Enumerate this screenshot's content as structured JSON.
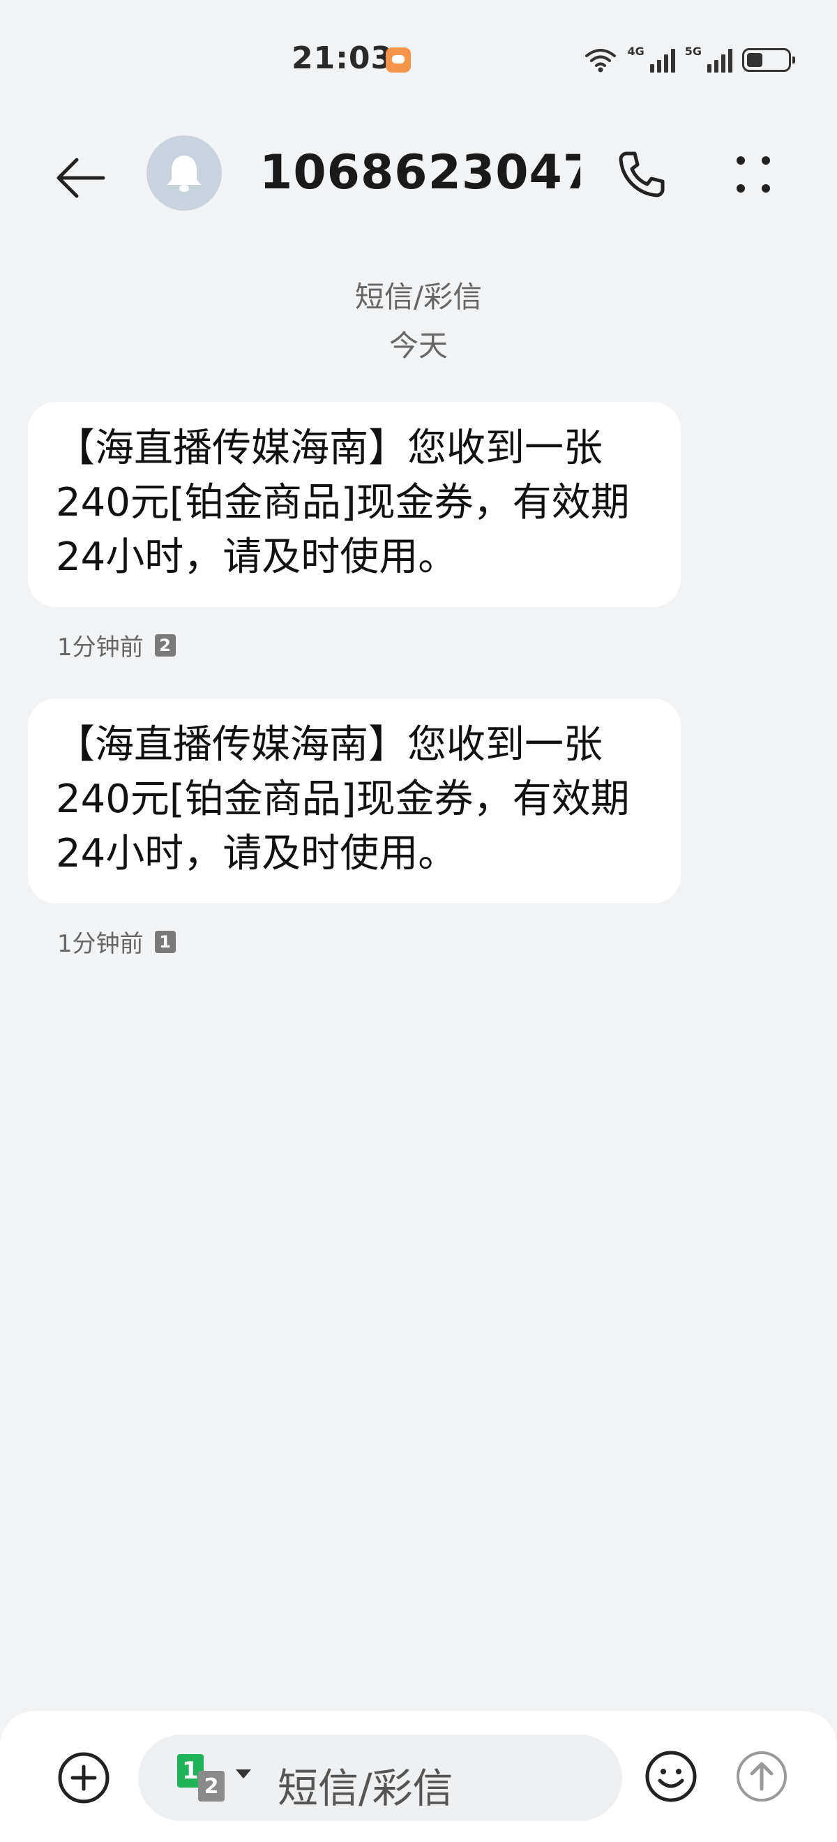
{
  "status_bar": {
    "time": "21:03",
    "network_1": "4G",
    "network_2": "5G"
  },
  "header": {
    "contact_name": "1068623047…",
    "avatar_icon": "bell-icon"
  },
  "conversation": {
    "type_label": "短信/彩信",
    "date_label": "今天"
  },
  "messages": [
    {
      "text": "【海直播传媒海南】您收到一张240元[铂金商品]现金券，有效期24小时，请及时使用。",
      "time": "1分钟前",
      "sim": "2"
    },
    {
      "text": "【海直播传媒海南】您收到一张240元[铂金商品]现金券，有效期24小时，请及时使用。",
      "time": "1分钟前",
      "sim": "1"
    }
  ],
  "input_bar": {
    "placeholder": "短信/彩信",
    "sim_primary": "1",
    "sim_secondary": "2"
  },
  "colors": {
    "background": "#f1f3f5",
    "bubble": "#ffffff",
    "sim1": "#20b358",
    "avatar": "#c9d3de"
  }
}
